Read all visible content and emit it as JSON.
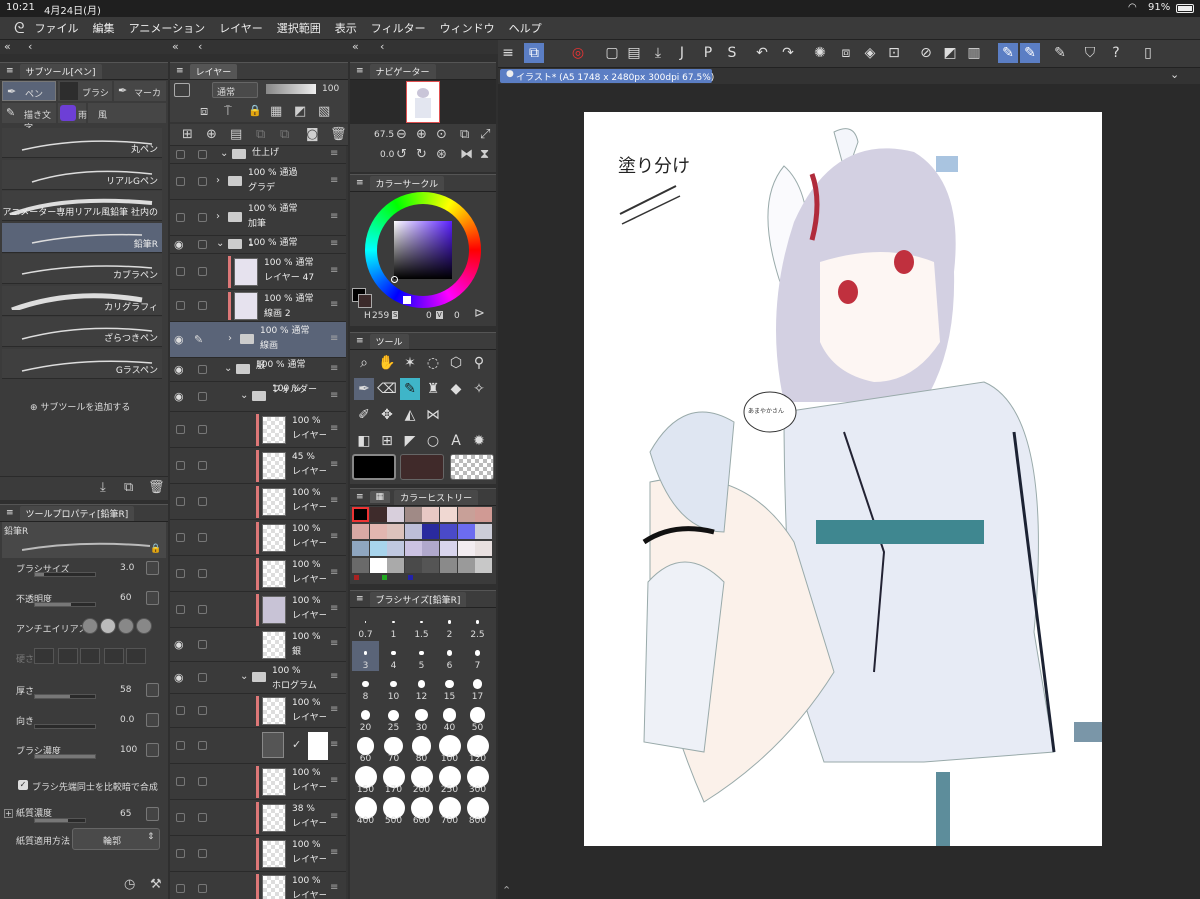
{
  "status": {
    "time": "10:21",
    "date": "4月24日(月)",
    "battery": "91%"
  },
  "menu": [
    "ファイル",
    "編集",
    "アニメーション",
    "レイヤー",
    "選択範囲",
    "表示",
    "フィルター",
    "ウィンドウ",
    "ヘルプ"
  ],
  "subtool": {
    "title": "サブツール[ペン]",
    "tabs": [
      "ペン",
      "ブラシ",
      "マーカー",
      "描き文字",
      "雨",
      "風"
    ],
    "items": [
      "丸ペン",
      "リアルGペン",
      "アニメーター専用リアル風鉛筆 社内の",
      "鉛筆R",
      "カブラペン",
      "カリグラフィ",
      "ざらつきペン",
      "Gラスペン"
    ],
    "add": "サブツールを追加する"
  },
  "props": {
    "title": "ツールプロパティ[鉛筆R]",
    "name": "鉛筆R",
    "rows": [
      {
        "label": "ブラシサイズ",
        "value": "3.0",
        "fill": 0.15
      },
      {
        "label": "不透明度",
        "value": "60",
        "fill": 0.6
      },
      {
        "label": "アンチエイリアス",
        "value": ""
      },
      {
        "label": "硬さ",
        "value": ""
      },
      {
        "label": "厚さ",
        "value": "58",
        "fill": 0.58
      },
      {
        "label": "向き",
        "value": "0.0",
        "fill": 0
      },
      {
        "label": "ブラシ濃度",
        "value": "100",
        "fill": 1
      }
    ],
    "check": "ブラシ先端同士を比較暗で合成",
    "paper": {
      "label": "紙質濃度",
      "value": "65",
      "fill": 0.65
    },
    "apply": {
      "label": "紙質適用方法",
      "value": "輪郭"
    }
  },
  "layer": {
    "title": "レイヤー",
    "blend": "通常",
    "opacity": "100",
    "items": [
      {
        "t1": "仕上げ",
        "t2": ""
      },
      {
        "t1": "100 % 通過",
        "t2": "グラデ"
      },
      {
        "t1": "100 % 通常",
        "t2": "加筆"
      },
      {
        "t1": "100 % 通常",
        "t2": "1"
      },
      {
        "t1": "100 % 通常",
        "t2": "レイヤー 47"
      },
      {
        "t1": "100 % 通常",
        "t2": "線画 2"
      },
      {
        "t1": "100 % 通常",
        "t2": "線画"
      },
      {
        "t1": "100 % 通常",
        "t2": "服"
      },
      {
        "t1": "100 %",
        "t2": "フォルダー"
      },
      {
        "t1": "100 %",
        "t2": "レイヤー"
      },
      {
        "t1": "45 %",
        "t2": "レイヤー"
      },
      {
        "t1": "100 %",
        "t2": "レイヤー"
      },
      {
        "t1": "100 %",
        "t2": "レイヤー"
      },
      {
        "t1": "100 %",
        "t2": "レイヤー"
      },
      {
        "t1": "100 %",
        "t2": "レイヤー"
      },
      {
        "t1": "100 %",
        "t2": "銀"
      },
      {
        "t1": "100 %",
        "t2": "ホログラム"
      },
      {
        "t1": "100 %",
        "t2": "レイヤー"
      },
      {
        "t1": "",
        "t2": ""
      },
      {
        "t1": "100 %",
        "t2": "レイヤー"
      },
      {
        "t1": "38 %",
        "t2": "レイヤー"
      },
      {
        "t1": "100 %",
        "t2": "レイヤー"
      },
      {
        "t1": "100 %",
        "t2": "レイヤー"
      }
    ]
  },
  "navigator": {
    "title": "ナビゲーター",
    "zoom": "67.5",
    "angle": "0.0"
  },
  "colorcircle": {
    "title": "カラーサークル",
    "h": "259",
    "s": "0",
    "v": "0",
    "hl": "H",
    "sl": "S",
    "vl": "V"
  },
  "tool": {
    "title": "ツール"
  },
  "history": {
    "title": "カラーヒストリー"
  },
  "brushsize": {
    "title": "ブラシサイズ[鉛筆R]",
    "sizes": [
      "0.7",
      "1",
      "1.5",
      "2",
      "2.5",
      "3",
      "4",
      "5",
      "6",
      "7",
      "8",
      "10",
      "12",
      "15",
      "17",
      "20",
      "25",
      "30",
      "40",
      "50",
      "60",
      "70",
      "80",
      "100",
      "120",
      "150",
      "170",
      "200",
      "250",
      "300",
      "400",
      "500",
      "600",
      "700",
      "800"
    ]
  },
  "canvas": {
    "tab": "イラスト* (A5 1748 x 2480px 300dpi 67.5%)",
    "note": "塗り分け",
    "bubble": "あまやかさん"
  },
  "colors": {
    "accent": "#5b7ec4",
    "panel": "#3b3b3b",
    "canvas_bg": "#2a2a2a"
  }
}
